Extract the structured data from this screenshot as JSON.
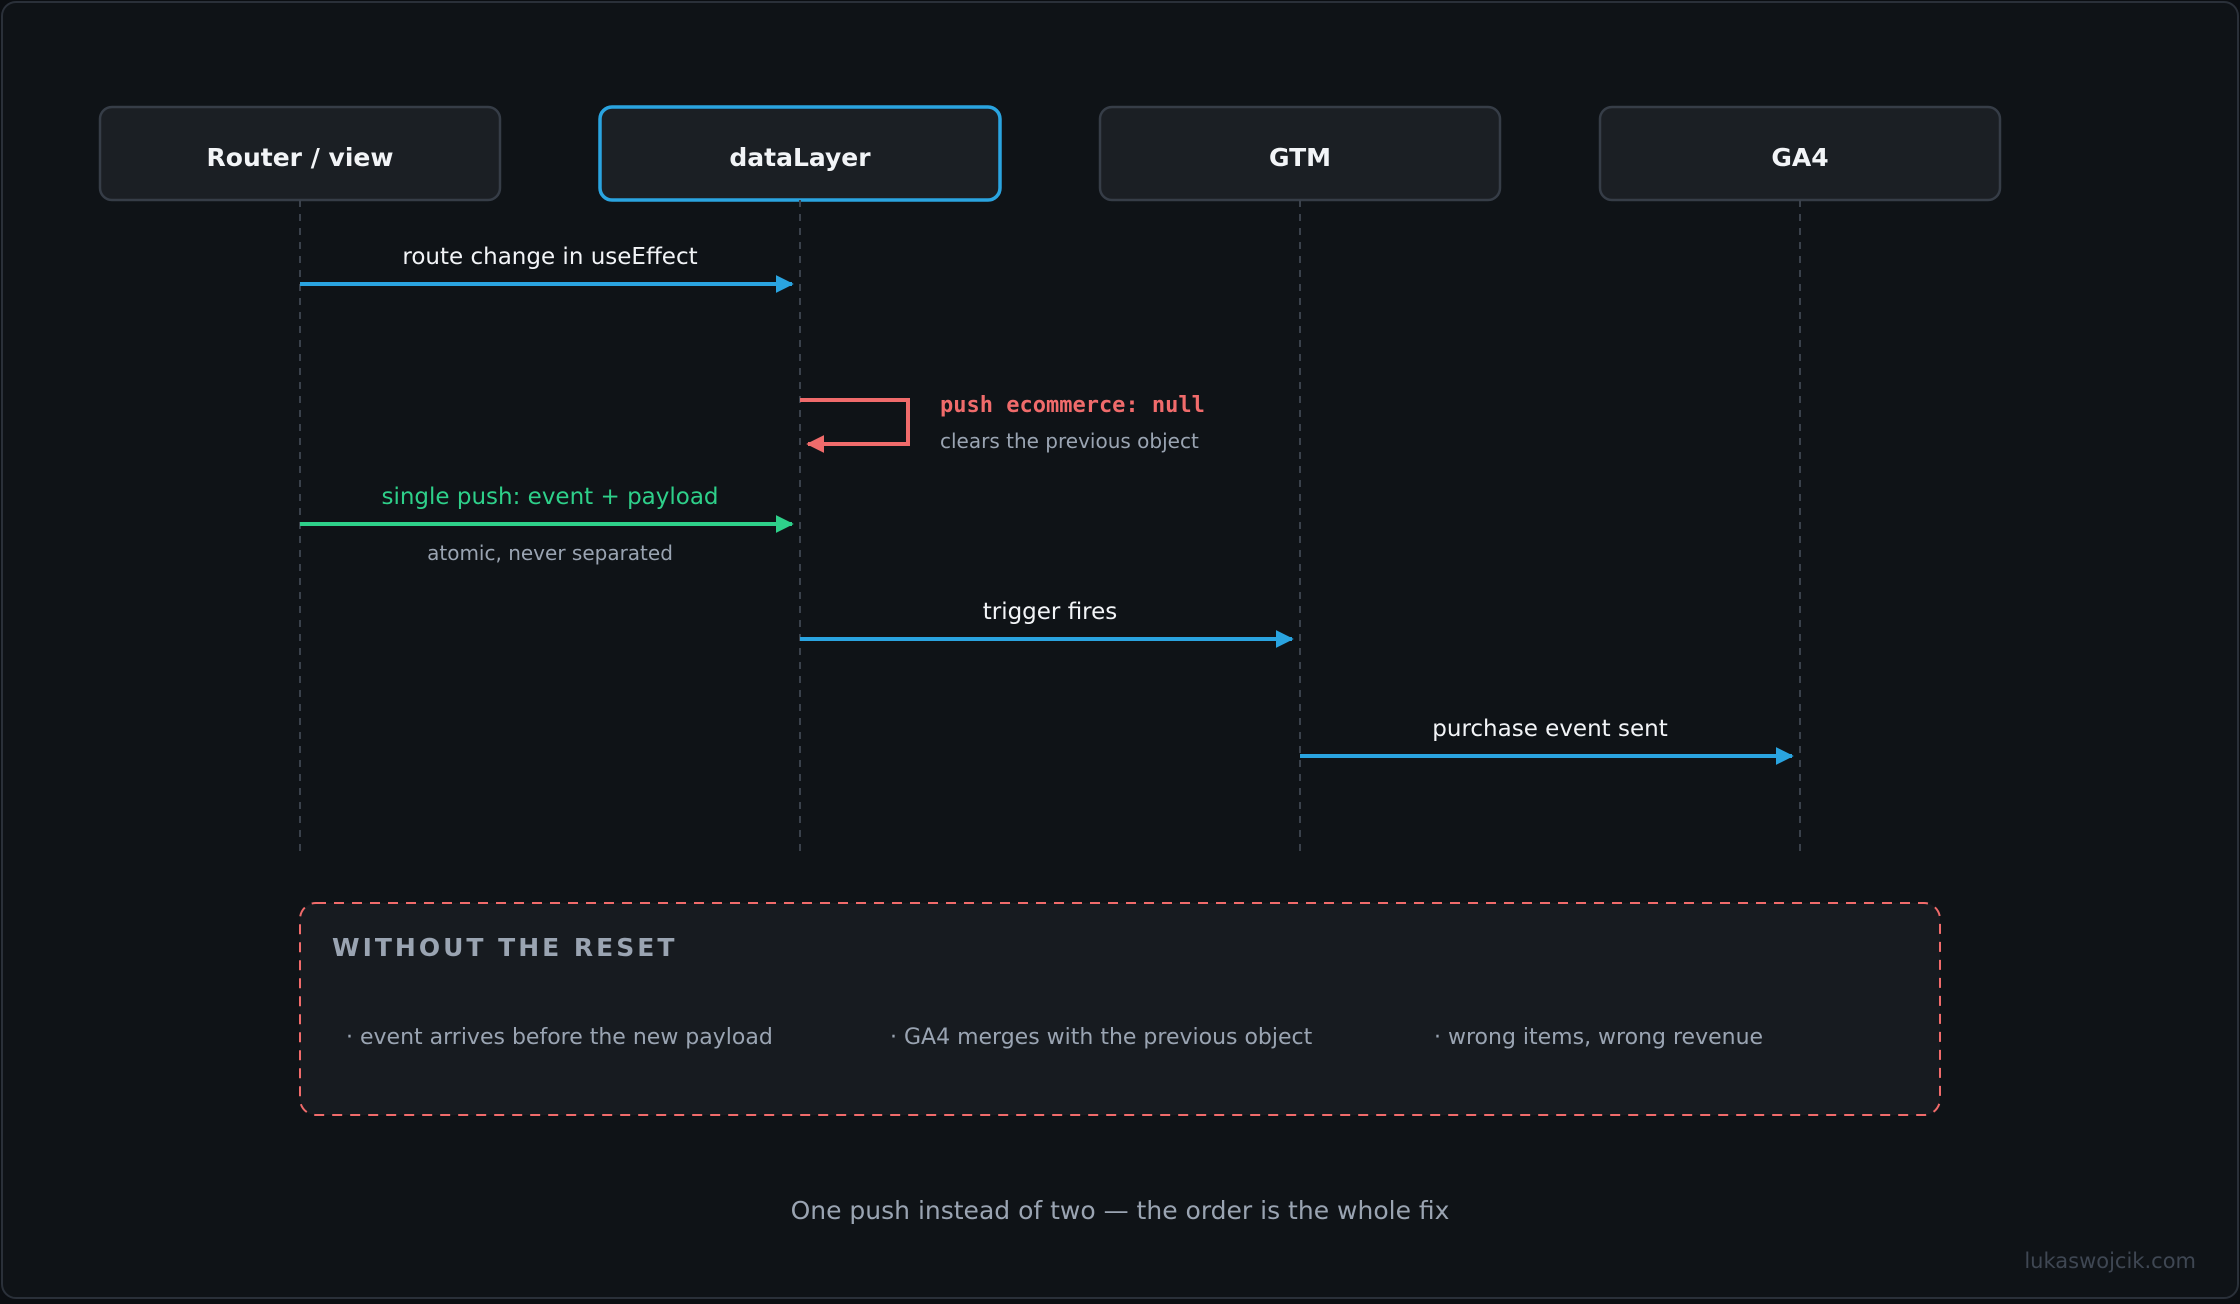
{
  "participants": {
    "router": "Router / view",
    "datalayer": "dataLayer",
    "gtm": "GTM",
    "ga4": "GA4"
  },
  "messages": {
    "route_change": "route change in useEffect",
    "reset_label": "push ecommerce: null",
    "reset_note": "clears the previous object",
    "single_push": "single push: event + payload",
    "single_push_note": "atomic, never separated",
    "trigger": "trigger fires",
    "purchase": "purchase event sent"
  },
  "warning": {
    "title": "WITHOUT THE RESET",
    "items": [
      "· event arrives before the new payload",
      "· GA4 merges with the previous object",
      "· wrong items, wrong revenue"
    ]
  },
  "caption": "One push instead of two — the order is the whole fix",
  "watermark": "lukaswojcik.com",
  "colors": {
    "background": "#0f1317",
    "box_fill": "#1b1f24",
    "box_border": "#363d47",
    "highlight_border": "#2aa4e0",
    "blue_arrow": "#2aa4e0",
    "green_arrow": "#2ed08a",
    "red_arrow": "#f06b6b",
    "text_primary": "#f2f4f7",
    "text_muted": "#9aa4b2"
  }
}
